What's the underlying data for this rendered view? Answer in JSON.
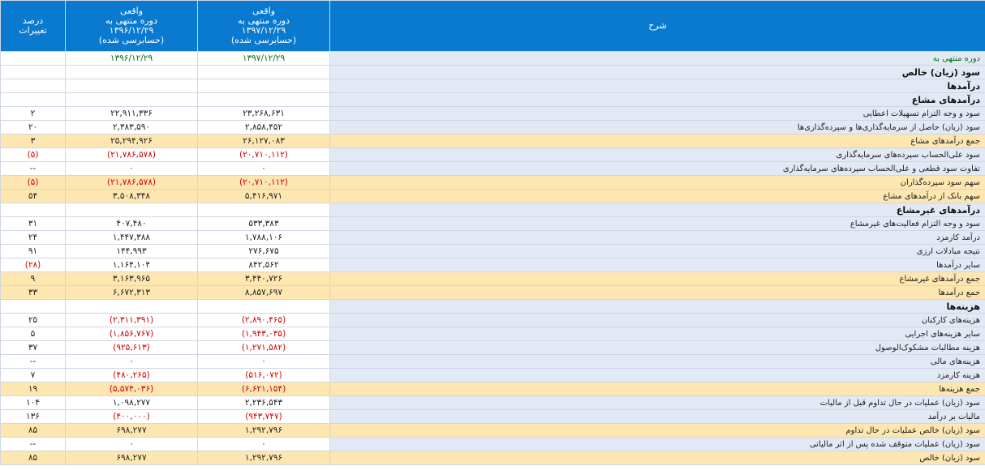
{
  "header": {
    "desc": "شرح",
    "col1": [
      "واقعی",
      "دوره منتهی به",
      "۱۳۹۷/۱۲/۲۹",
      "(حسابرسی شده)"
    ],
    "col2": [
      "واقعی",
      "دوره منتهی به",
      "۱۳۹۶/۱۲/۲۹",
      "(حسابرسی شده)"
    ],
    "col3": [
      "درصد",
      "تغییرات"
    ]
  },
  "rows": [
    {
      "type": "hdr",
      "desc": "دوره منتهی به",
      "a": "۱۳۹۷/۱۲/۲۹",
      "b": "۱۳۹۶/۱۲/۲۹",
      "p": ""
    },
    {
      "type": "sec",
      "desc": "سود (زیان) خالص",
      "a": "",
      "b": "",
      "p": ""
    },
    {
      "type": "sec",
      "desc": "درآمدها",
      "a": "",
      "b": "",
      "p": ""
    },
    {
      "type": "sec",
      "desc": "درآمدهای مشاع",
      "a": "",
      "b": "",
      "p": ""
    },
    {
      "type": "row",
      "desc": "سود و وجه التزام تسهیلات اعطایی",
      "a": "۲۳,۲۶۸,۶۳۱",
      "b": "۲۲,۹۱۱,۳۳۶",
      "p": "۲"
    },
    {
      "type": "row",
      "desc": "سود (زیان) حاصل از سرمایه‌گذاری‌ها و سپرده‌گذاری‌ها",
      "a": "۲,۸۵۸,۴۵۲",
      "b": "۲,۳۸۳,۵۹۰",
      "p": "۲۰"
    },
    {
      "type": "total",
      "desc": "جمع درآمدهای مشاع",
      "a": "۲۶,۱۲۷,۰۸۳",
      "b": "۲۵,۲۹۴,۹۲۶",
      "p": "۳"
    },
    {
      "type": "row",
      "desc": "سود علی‌الحساب سپرده‌های سرمایه‌گذاری",
      "a": "(۲۰,۷۱۰,۱۱۲)",
      "b": "(۲۱,۷۸۶,۵۷۸)",
      "p": "(۵)",
      "neg": true
    },
    {
      "type": "row",
      "desc": "تفاوت سود قطعی و علی‌الحساب سپرده‌های سرمایه‌گذاری",
      "a": "۰",
      "b": "۰",
      "p": "--"
    },
    {
      "type": "total",
      "desc": "سهم سود سپرده‌گذاران",
      "a": "(۲۰,۷۱۰,۱۱۲)",
      "b": "(۲۱,۷۸۶,۵۷۸)",
      "p": "(۵)",
      "neg": true
    },
    {
      "type": "total",
      "desc": "سهم بانک از درآمدهای مشاع",
      "a": "۵,۴۱۶,۹۷۱",
      "b": "۳,۵۰۸,۳۴۸",
      "p": "۵۴"
    },
    {
      "type": "sec",
      "desc": "درآمدهای غیرمشاع",
      "a": "",
      "b": "",
      "p": ""
    },
    {
      "type": "row",
      "desc": "سود و وجه التزام فعالیت‌های غیرمشاع",
      "a": "۵۳۳,۳۸۳",
      "b": "۴۰۷,۴۸۰",
      "p": "۳۱"
    },
    {
      "type": "row",
      "desc": "درآمد کارمزد",
      "a": "۱,۷۸۸,۱۰۶",
      "b": "۱,۴۴۷,۳۸۸",
      "p": "۲۴"
    },
    {
      "type": "row",
      "desc": "نتیجه مبادلات ارزی",
      "a": "۲۷۶,۶۷۵",
      "b": "۱۴۴,۹۹۳",
      "p": "۹۱"
    },
    {
      "type": "row",
      "desc": "سایر درآمدها",
      "a": "۸۴۲,۵۶۲",
      "b": "۱,۱۶۴,۱۰۴",
      "p": "(۲۸)",
      "negp": true
    },
    {
      "type": "total",
      "desc": "جمع درآمدهای غیرمشاع",
      "a": "۳,۴۴۰,۷۲۶",
      "b": "۳,۱۶۳,۹۶۵",
      "p": "۹"
    },
    {
      "type": "total",
      "desc": "جمع درآمدها",
      "a": "۸,۸۵۷,۶۹۷",
      "b": "۶,۶۷۲,۳۱۳",
      "p": "۳۳"
    },
    {
      "type": "sec",
      "desc": "هزینه‌ها",
      "a": "",
      "b": "",
      "p": ""
    },
    {
      "type": "row",
      "desc": "هزینه‌های کارکنان",
      "a": "(۲,۸۹۰,۴۶۵)",
      "b": "(۲,۳۱۱,۳۹۱)",
      "p": "۲۵",
      "negab": true
    },
    {
      "type": "row",
      "desc": "سایر هزینه‌های اجرایی",
      "a": "(۱,۹۴۳,۰۳۵)",
      "b": "(۱,۸۵۶,۷۶۷)",
      "p": "۵",
      "negab": true
    },
    {
      "type": "row",
      "desc": "هزینه مطالبات مشکوک‌الوصول",
      "a": "(۱,۲۷۱,۵۸۲)",
      "b": "(۹۲۵,۶۱۳)",
      "p": "۳۷",
      "negab": true
    },
    {
      "type": "row",
      "desc": "هزینه‌های مالی",
      "a": "۰",
      "b": "۰",
      "p": "--"
    },
    {
      "type": "row",
      "desc": "هزینه کارمزد",
      "a": "(۵۱۶,۰۷۲)",
      "b": "(۴۸۰,۲۶۵)",
      "p": "۷",
      "negab": true
    },
    {
      "type": "total",
      "desc": "جمع هزینه‌ها",
      "a": "(۶,۶۲۱,۱۵۴)",
      "b": "(۵,۵۷۴,۰۳۶)",
      "p": "۱۹",
      "negab": true
    },
    {
      "type": "row",
      "desc": "سود (زیان) عملیات در حال تداوم قبل از مالیات",
      "a": "۲,۲۳۶,۵۴۳",
      "b": "۱,۰۹۸,۲۷۷",
      "p": "۱۰۴"
    },
    {
      "type": "row",
      "desc": "مالیات بر درآمد",
      "a": "(۹۴۳,۷۴۷)",
      "b": "(۴۰۰,۰۰۰)",
      "p": "۱۳۶",
      "negab": true
    },
    {
      "type": "total",
      "desc": "سود (زیان) خالص عملیات در حال تداوم",
      "a": "۱,۲۹۲,۷۹۶",
      "b": "۶۹۸,۲۷۷",
      "p": "۸۵"
    },
    {
      "type": "row",
      "desc": "سود (زیان) عملیات متوقف شده پس از اثر مالیاتی",
      "a": "۰",
      "b": "۰",
      "p": "--"
    },
    {
      "type": "total",
      "desc": "سود (زیان) خالص",
      "a": "۱,۲۹۲,۷۹۶",
      "b": "۶۹۸,۲۷۷",
      "p": "۸۵"
    }
  ]
}
